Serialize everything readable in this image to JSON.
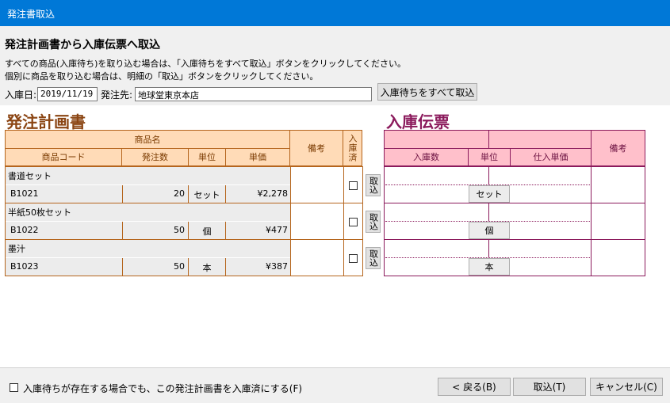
{
  "window": {
    "title": "発注書取込"
  },
  "heading": "発注計画書から入庫伝票へ取込",
  "instructions": [
    "すべての商品(入庫待ち)を取り込む場合は、「入庫待ちをすべて取込」ボタンをクリックしてください。",
    "個別に商品を取り込む場合は、明細の「取込」ボタンをクリックしてください。"
  ],
  "form": {
    "date_label": "入庫日:",
    "date_value": "2019/11/19",
    "supplier_label": "発注先:",
    "supplier_value": "地球堂東京本店",
    "import_all_button": "入庫待ちをすべて取込"
  },
  "order": {
    "title": "発注計画書",
    "headers": {
      "product_name": "商品名",
      "product_code": "商品コード",
      "order_qty": "発注数",
      "unit": "単位",
      "unit_price": "単価",
      "remarks": "備考",
      "received": "入庫済"
    },
    "rows": [
      {
        "name": "書道セット",
        "code": "B1021",
        "qty": "20",
        "unit": "セット",
        "price": "¥2,278"
      },
      {
        "name": "半紙50枚セット",
        "code": "B1022",
        "qty": "50",
        "unit": "個",
        "price": "¥477"
      },
      {
        "name": "墨汁",
        "code": "B1023",
        "qty": "50",
        "unit": "本",
        "price": "¥387"
      }
    ],
    "row_button_label": "取込"
  },
  "receipt": {
    "title": "入庫伝票",
    "headers": {
      "receive_qty": "入庫数",
      "unit": "単位",
      "purchase_price": "仕入単価",
      "remarks": "備考"
    },
    "rows": [
      {
        "unit": "セット"
      },
      {
        "unit": "個"
      },
      {
        "unit": "本"
      }
    ]
  },
  "footer": {
    "checkbox_label": "入庫待ちが存在する場合でも、この発注計画書を入庫済にする(F)",
    "back_button": "< 戻る(B)",
    "import_button": "取込(T)",
    "cancel_button": "キャンセル(C)"
  }
}
